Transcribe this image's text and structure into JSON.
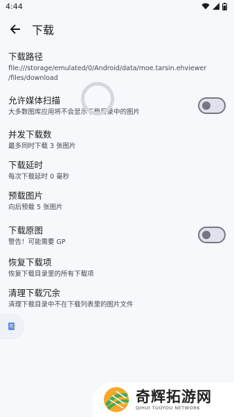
{
  "status_bar": {
    "time": "4:44"
  },
  "app_bar": {
    "title": "下载"
  },
  "prefs": [
    {
      "title": "下载路径",
      "summary_lines": [
        "file:///storage/emulated/0/Android/data/moe.tarsin.ehviewer",
        "/files/download"
      ]
    },
    {
      "title": "允许媒体扫描",
      "summary": "大多数图库应用将不会显示下载目录中的图片",
      "toggle_on": false
    },
    {
      "title": "并发下载数",
      "summary": "最多同时下载 3 张图片"
    },
    {
      "title": "下载延时",
      "summary": "每次下载延时 0 毫秒"
    },
    {
      "title": "预载图片",
      "summary": "向后预载 5 张图片"
    },
    {
      "title": "下载原图",
      "summary": "警告！可能需要 GP",
      "toggle_on": false
    },
    {
      "title": "恢复下载项",
      "summary": "恢复下载目录里的所有下载项"
    },
    {
      "title": "清理下载冗余",
      "summary": "清理下载目录中不在下载列表里的图片文件"
    }
  ],
  "watermark": {
    "cn": "奇辉拓游网",
    "en": "QIHUI TUOYOU NETWORK"
  },
  "colors": {
    "background": "#f6f8fc",
    "toggle_outline": "#74777f",
    "toggle_track": "#dfe2eb"
  }
}
